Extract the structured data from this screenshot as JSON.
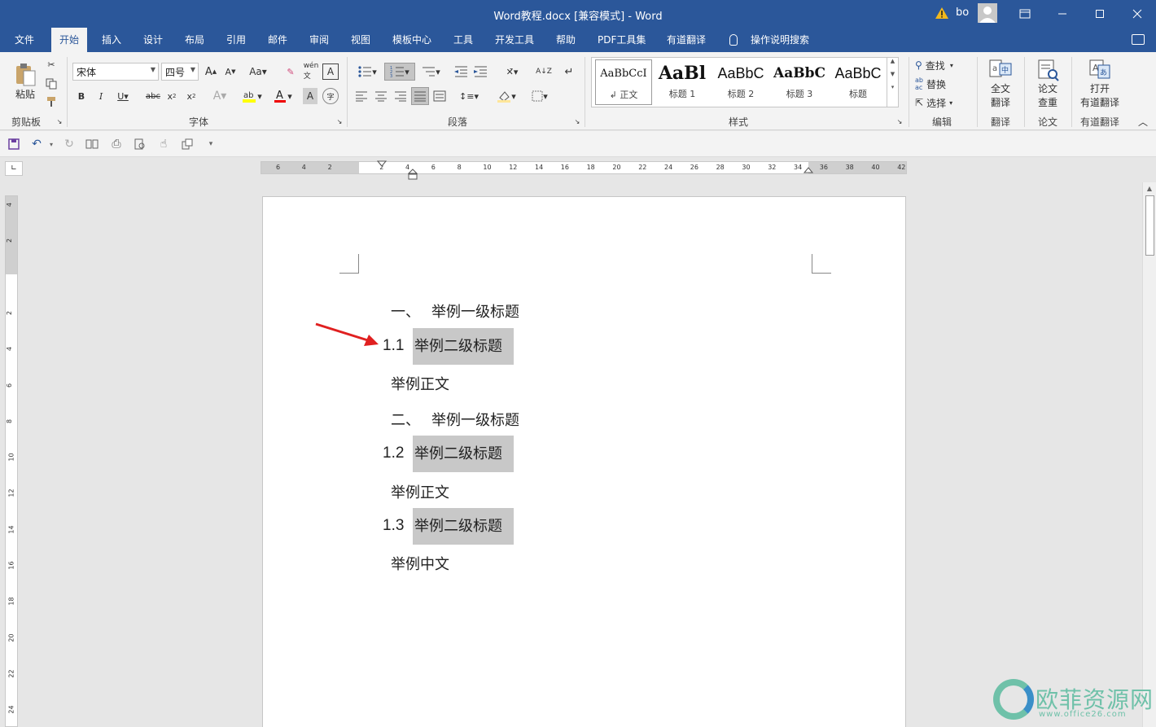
{
  "window": {
    "title": "Word教程.docx [兼容模式]  -  Word",
    "user_name": "bo",
    "minimize_icon": "minimize-icon",
    "restore_icon": "restore-icon",
    "close_icon": "close-icon"
  },
  "tabs": [
    "文件",
    "开始",
    "插入",
    "设计",
    "布局",
    "引用",
    "邮件",
    "审阅",
    "视图",
    "模板中心",
    "工具",
    "开发工具",
    "帮助",
    "PDF工具集",
    "有道翻译"
  ],
  "active_tab": "开始",
  "tell_me": "操作说明搜索",
  "ribbon": {
    "clipboard": {
      "paste_label": "粘贴",
      "group_label": "剪贴板"
    },
    "font": {
      "font_name": "宋体",
      "font_size": "四号",
      "group_label": "字体"
    },
    "paragraph": {
      "group_label": "段落"
    },
    "styles": {
      "group_label": "样式",
      "items": [
        {
          "sample": "AaBbCcI",
          "name": "↲ 正文"
        },
        {
          "sample": "AaBl",
          "name": "标题 1"
        },
        {
          "sample": "AaBbC",
          "name": "标题 2"
        },
        {
          "sample": "AaBbC",
          "name": "标题 3"
        },
        {
          "sample": "AaBbC",
          "name": "标题"
        }
      ]
    },
    "editing": {
      "find": "查找",
      "replace": "替换",
      "select": "选择",
      "group_label": "编辑"
    },
    "translate": {
      "full_text_line1": "全文",
      "full_text_line2": "翻译",
      "group_label": "翻译"
    },
    "paper": {
      "check_line1": "论文",
      "check_line2": "查重",
      "group_label": "论文"
    },
    "youdao": {
      "open_line1": "打开",
      "open_line2": "有道翻译",
      "group_label": "有道翻译"
    }
  },
  "ruler": {
    "h_ticks": [
      "6",
      "4",
      "2",
      "",
      "2",
      "4",
      "6",
      "8",
      "10",
      "12",
      "14",
      "16",
      "18",
      "20",
      "22",
      "24",
      "26",
      "28",
      "30",
      "32",
      "34",
      "36",
      "38",
      "40",
      "42"
    ],
    "v_ticks": [
      "4",
      "2",
      "",
      "2",
      "4",
      "6",
      "8",
      "10",
      "12",
      "14",
      "16",
      "18",
      "20",
      "22",
      "24"
    ]
  },
  "document": {
    "paragraphs": [
      {
        "type": "h1",
        "number": "一、",
        "text": "举例一级标题"
      },
      {
        "type": "h2",
        "number": "1.1",
        "text": "举例二级标题"
      },
      {
        "type": "body",
        "text": "举例正文"
      },
      {
        "type": "h1",
        "number": "二、",
        "text": "举例一级标题"
      },
      {
        "type": "h2",
        "number": "1.2",
        "text": "举例二级标题"
      },
      {
        "type": "body",
        "text": "举例正文"
      },
      {
        "type": "h2",
        "number": "1.3",
        "text": "举例二级标题"
      },
      {
        "type": "body",
        "text": "举例中文"
      }
    ]
  },
  "watermark": {
    "text": "欧菲资源网",
    "url": "www.office26.com"
  },
  "colors": {
    "accent": "#2b579a",
    "highlight": "#c8c8c8",
    "arrow": "#e02020"
  }
}
